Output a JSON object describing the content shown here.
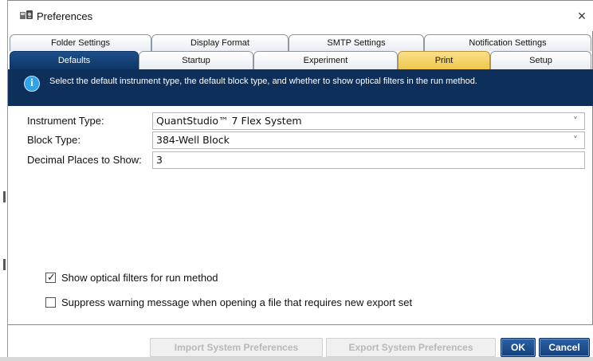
{
  "window": {
    "title": "Preferences",
    "close_glyph": "×",
    "app_icon": "preferences-app-icon"
  },
  "tabs": {
    "row1": [
      "Folder Settings",
      "Display Format",
      "SMTP Settings",
      "Notification Settings"
    ],
    "row2": [
      "Defaults",
      "Startup",
      "Experiment",
      "Print",
      "Setup"
    ],
    "active": "Defaults",
    "highlighted": "Print"
  },
  "info": {
    "icon_glyph": "i",
    "text": "Select the default instrument type, the default block type, and whether to show optical filters in the run method."
  },
  "form": {
    "instrument_type": {
      "label": "Instrument Type:",
      "value": "QuantStudio™ 7 Flex System"
    },
    "block_type": {
      "label": "Block Type:",
      "value": "384-Well Block"
    },
    "decimal_places": {
      "label": "Decimal Places to Show:",
      "value": "3"
    },
    "chevron_glyph": "˅"
  },
  "options": {
    "show_optical_filters": {
      "label": "Show optical filters for run method",
      "checked": true
    },
    "suppress_warning": {
      "label": "Suppress warning message when opening a file that requires new export set",
      "checked": false
    },
    "check_glyph": "✓"
  },
  "footer": {
    "import_label": "Import System Preferences",
    "export_label": "Export System Preferences",
    "ok_label": "OK",
    "cancel_label": "Cancel"
  },
  "colors": {
    "accent_dark_blue": "#0e2f5a",
    "active_tab": "#1d4f8a",
    "print_tab": "#f0c74a",
    "info_icon": "#2fa3e6"
  }
}
